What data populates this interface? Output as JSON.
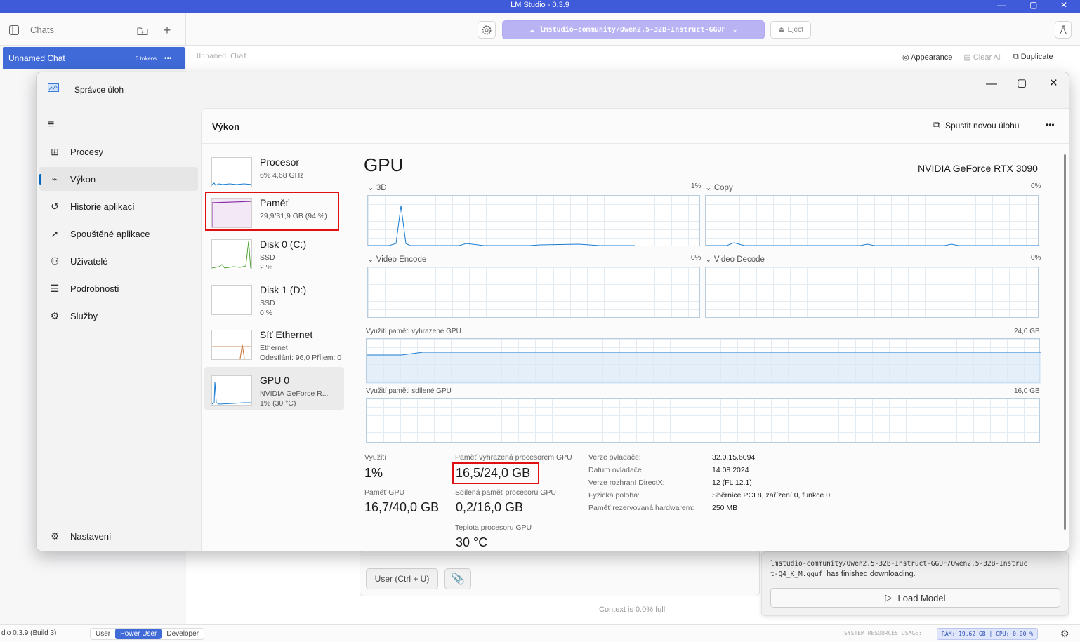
{
  "app": {
    "title": "LM Studio - 0.3.9",
    "window_controls": {
      "minimize": "—",
      "maximize": "▢",
      "close": "✕"
    }
  },
  "sidebar": {
    "chats_label": "Chats",
    "active_chat": {
      "title": "Unnamed Chat",
      "tokens": "0 tokens",
      "menu": "•••"
    }
  },
  "toolbar": {
    "model_selector": "lmstudio-community/Qwen2.5-32B-Instruct-GGUF",
    "eject_label": "Eject",
    "chat_title": "Unnamed Chat",
    "appearance_label": "Appearance",
    "clear_all_label": "Clear All",
    "duplicate_label": "Duplicate"
  },
  "composer": {
    "input_placeholder": "User (Ctrl + U)",
    "context_status": "Context is 0.0% full"
  },
  "notification": {
    "path": "lmstudio-community/Qwen2.5-32B-Instruct-GGUF/Qwen2.5-32B-Instruct-Q4_K_M.gguf",
    "message": "has finished downloading.",
    "path_line1": "lmstudio-community/Qwen2.5-32B-Instruct-GGUF/Qwen2.5-32B-Instruc",
    "path_line2": "t-Q4_K_M.gguf",
    "load_button": "Load Model"
  },
  "statusbar": {
    "version": "dio 0.3.9 (Build 3)",
    "modes": [
      "User",
      "Power User",
      "Developer"
    ],
    "active_mode": "Power User",
    "resources_label": "SYSTEM RESOURCES USAGE:",
    "ram": "RAM: 19.62 GB",
    "cpu": "CPU: 0.00 %"
  },
  "task_manager": {
    "title": "Správce úloh",
    "nav": [
      {
        "label": "Procesy",
        "icon": "processes-icon"
      },
      {
        "label": "Výkon",
        "icon": "performance-icon"
      },
      {
        "label": "Historie aplikací",
        "icon": "history-icon"
      },
      {
        "label": "Spouštěné aplikace",
        "icon": "startup-icon"
      },
      {
        "label": "Uživatelé",
        "icon": "users-icon"
      },
      {
        "label": "Podrobnosti",
        "icon": "details-icon"
      },
      {
        "label": "Služby",
        "icon": "services-icon"
      }
    ],
    "settings_label": "Nastavení",
    "header_title": "Výkon",
    "new_task_label": "Spustit novou úlohu",
    "more": "•••",
    "resources": [
      {
        "name": "Procesor",
        "line1": "6% 4,68 GHz",
        "line2": ""
      },
      {
        "name": "Paměť",
        "line1": "29,9/31,9 GB (94 %)",
        "line2": ""
      },
      {
        "name": "Disk 0 (C:)",
        "line1": "SSD",
        "line2": "2 %"
      },
      {
        "name": "Disk 1 (D:)",
        "line1": "SSD",
        "line2": "0 %"
      },
      {
        "name": "Síť Ethernet",
        "line1": "Ethernet",
        "line2": "Odesílání: 96,0 Příjem: 0"
      },
      {
        "name": "GPU 0",
        "line1": "NVIDIA GeForce R...",
        "line2": "1% (30 °C)"
      }
    ],
    "gpu": {
      "title": "GPU",
      "model": "NVIDIA GeForce RTX 3090",
      "engines": [
        {
          "name": "3D",
          "value": "1%"
        },
        {
          "name": "Copy",
          "value": "0%"
        },
        {
          "name": "Video Encode",
          "value": "0%"
        },
        {
          "name": "Video Decode",
          "value": "0%"
        }
      ],
      "dedicated_label": "Využití paměti vyhrazené GPU",
      "dedicated_max": "24,0 GB",
      "shared_label": "Využití paměti sdílené GPU",
      "shared_max": "16,0 GB",
      "stats": {
        "utilization_label": "Využití",
        "utilization_value": "1%",
        "gpu_memory_label": "Paměť GPU",
        "gpu_memory_value": "16,7/40,0 GB",
        "dedicated_mem_label": "Paměť vyhrazená procesorem GPU",
        "dedicated_mem_value": "16,5/24,0 GB",
        "shared_mem_label": "Sdílená paměť procesoru GPU",
        "shared_mem_value": "0,2/16,0 GB",
        "temp_label": "Teplota procesoru GPU",
        "temp_value": "30 °C"
      },
      "details": [
        {
          "key": "Verze ovladače:",
          "value": "32.0.15.6094"
        },
        {
          "key": "Datum ovladače:",
          "value": "14.08.2024"
        },
        {
          "key": "Verze rozhraní DirectX:",
          "value": "12 (FL 12.1)"
        },
        {
          "key": "Fyzická poloha:",
          "value": "Sběrnice PCI 8, zařízení 0, funkce 0"
        },
        {
          "key": "Paměť rezervovaná hardwarem:",
          "value": "250 MB"
        }
      ]
    }
  }
}
